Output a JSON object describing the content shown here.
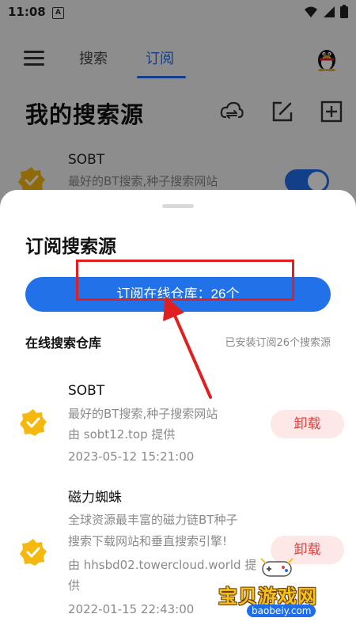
{
  "status_bar": {
    "time": "11:08",
    "notif_letter": "A",
    "icons": [
      "wifi-icon",
      "signal-icon",
      "battery-icon"
    ]
  },
  "background": {
    "tabs": [
      "搜索",
      "订阅"
    ],
    "active_tab": "订阅",
    "title": "我的搜索源",
    "header_icons": [
      "cloud-sync-icon",
      "edit-icon",
      "add-icon"
    ],
    "item": {
      "name": "SOBT",
      "desc": "最好的BT搜索,种子搜索网站",
      "enabled": true
    }
  },
  "sheet": {
    "title": "订阅搜索源",
    "subscribe_button": "订阅在线仓库：26个",
    "repo_label": "在线搜索仓库",
    "installed_text": "已安装订阅26个搜索源",
    "items": [
      {
        "name": "SOBT",
        "desc_lines": [
          "最好的BT搜索,种子搜索网站"
        ],
        "provider_lines": [
          "由 sobt12.top 提供"
        ],
        "date": "2023-05-12 15:21:00",
        "action": "卸载"
      },
      {
        "name": "磁力蜘蛛",
        "desc_lines": [
          "全球资源最丰富的磁力链BT种子",
          "搜索下载网站和垂直搜索引擎!"
        ],
        "provider_lines": [
          "由 hhsbd02.towercloud.world 提",
          "供"
        ],
        "date": "2022-01-15 22:43:00",
        "action": "卸载"
      }
    ]
  },
  "watermark": {
    "text": "宝贝游戏网",
    "url": "baobeiy.com"
  },
  "colors": {
    "accent": "#2171e8",
    "annotation_red": "#e02020",
    "uninstall_bg": "#fde7e7",
    "uninstall_text": "#e0403f",
    "badge": "#f5b80f"
  }
}
